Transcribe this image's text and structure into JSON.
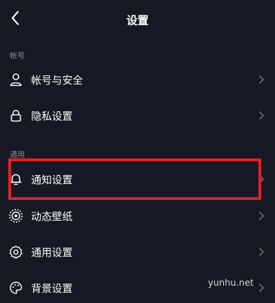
{
  "header": {
    "title": "设置"
  },
  "sections": {
    "account": {
      "label": "帐号"
    },
    "general": {
      "label": "通用"
    }
  },
  "items": [
    {
      "label": "帐号与安全",
      "icon": "user-icon"
    },
    {
      "label": "隐私设置",
      "icon": "lock-icon"
    },
    {
      "label": "通知设置",
      "icon": "bell-icon"
    },
    {
      "label": "动态壁纸",
      "icon": "wallpaper-icon"
    },
    {
      "label": "通用设置",
      "icon": "gear-icon"
    },
    {
      "label": "背景设置",
      "icon": "palette-icon"
    }
  ],
  "watermark": "yunhu.net",
  "colors": {
    "background": "#161823",
    "section_label": "#8a8b91",
    "highlight": "#e0222a"
  }
}
